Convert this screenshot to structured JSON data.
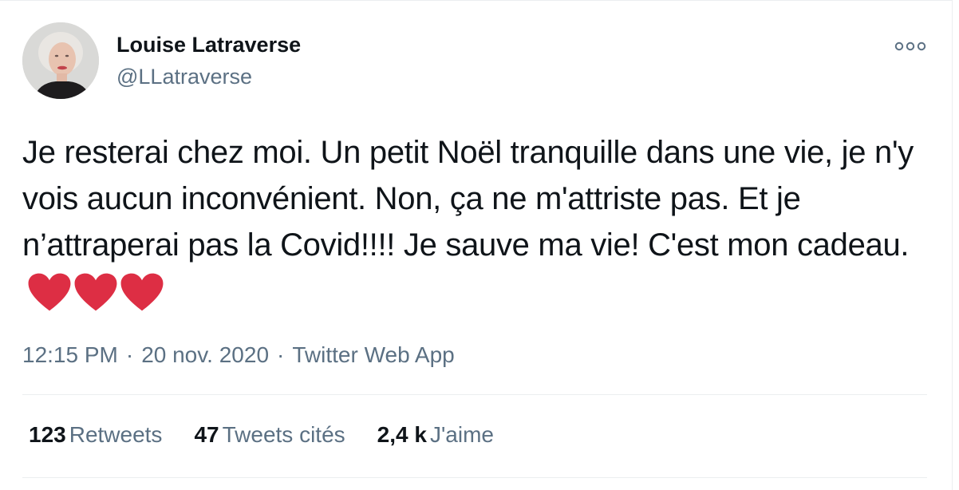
{
  "tweet": {
    "author": {
      "name": "Louise Latraverse",
      "handle": "@LLatraverse"
    },
    "text": "Je resterai chez moi. Un petit Noël tranquille dans une vie, je n'y vois aucun inconvénient. Non, ça ne m'attriste pas. Et je n’attraperai pas la Covid!!!! Je sauve ma vie! C'est mon cadeau.",
    "emoji": [
      "red-heart",
      "red-heart",
      "red-heart"
    ],
    "time": "12:15 PM",
    "date": "20 nov. 2020",
    "separator": "·",
    "source": "Twitter Web App",
    "stats": {
      "retweets": {
        "count": "123",
        "label": "Retweets"
      },
      "quotes": {
        "count": "47",
        "label": "Tweets cités"
      },
      "likes": {
        "count": "2,4 k",
        "label": "J'aime"
      }
    }
  },
  "colors": {
    "text_primary": "#0f1419",
    "text_secondary": "#5b7083",
    "divider": "#ebeef0",
    "heart": "#dd2e44"
  },
  "icons": {
    "more": "more-horizontal-icon"
  }
}
